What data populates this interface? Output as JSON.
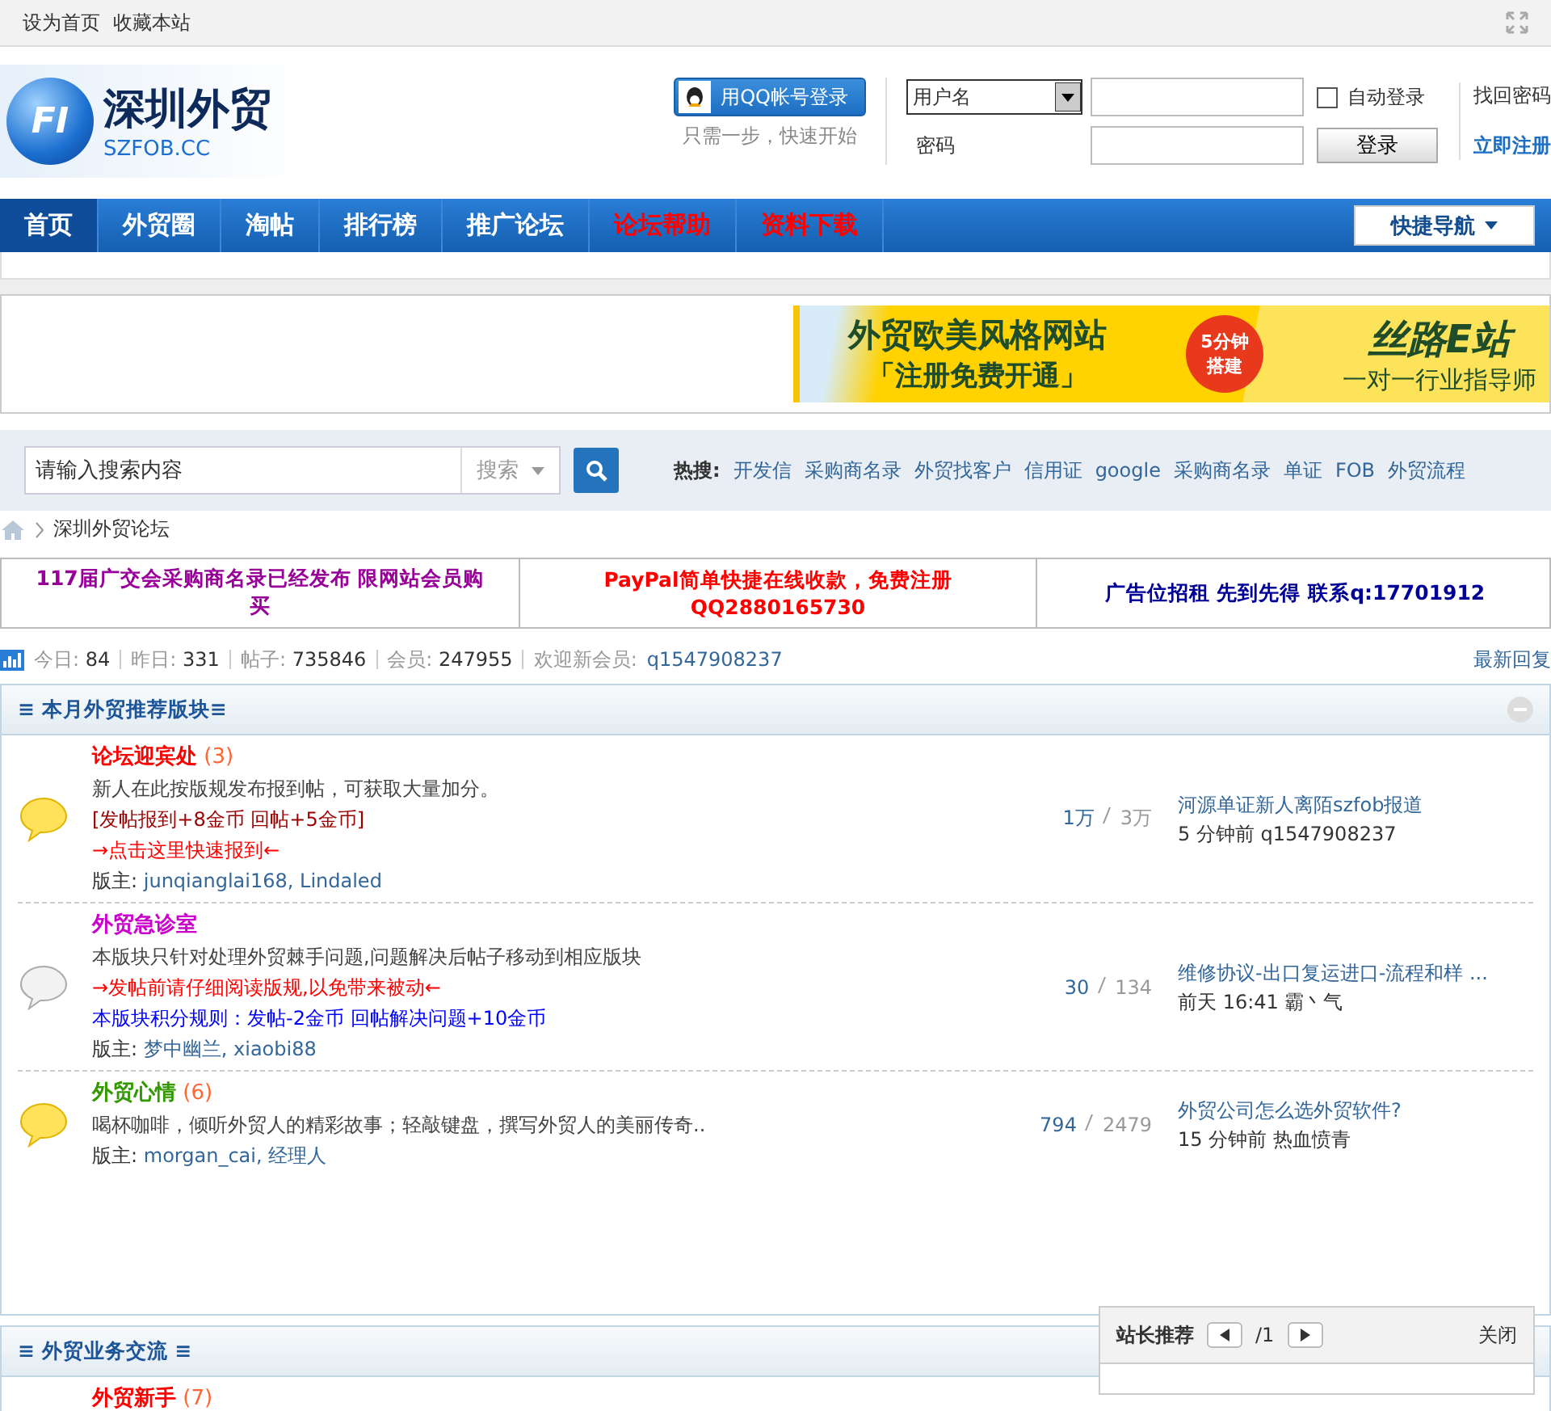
{
  "topbar": {
    "links": [
      "设为首页",
      "收藏本站"
    ]
  },
  "header": {
    "logo": {
      "mark": "FI",
      "name": "深圳外贸",
      "domain": "SZFOB.CC"
    },
    "qq_login": {
      "label": "用QQ帐号登录",
      "hint": "只需一步，快速开始"
    },
    "login": {
      "account_type": "用户名",
      "password_label": "密码",
      "auto_login": {
        "label": "自动登录",
        "checked": false
      },
      "submit": "登录",
      "links": [
        "找回密码",
        "立即注册"
      ]
    }
  },
  "nav": {
    "items": [
      {
        "label": "首页",
        "selected": true,
        "highlight": false
      },
      {
        "label": "外贸圈",
        "selected": false,
        "highlight": false
      },
      {
        "label": "淘帖",
        "selected": false,
        "highlight": false
      },
      {
        "label": "排行榜",
        "selected": false,
        "highlight": false
      },
      {
        "label": "推广论坛",
        "selected": false,
        "highlight": false
      },
      {
        "label": "论坛帮助",
        "selected": false,
        "highlight": true
      },
      {
        "label": "资料下载",
        "selected": false,
        "highlight": true
      }
    ],
    "quick_nav": "快捷导航"
  },
  "banner": {
    "headline": "外贸欧美风格网站",
    "subline": "「注册免费开通」",
    "badge": [
      "5分钟",
      "搭建"
    ],
    "brand": "丝路E站",
    "slogan": "一对一行业指导师"
  },
  "search": {
    "placeholder": "请输入搜索内容",
    "scope": "搜索",
    "hot_label": "热搜:",
    "hot": [
      "开发信",
      "采购商名录",
      "外贸找客户",
      "信用证",
      "google",
      "采购商名录",
      "单证",
      "FOB",
      "外贸流程"
    ]
  },
  "breadcrumb": [
    "深圳外贸论坛"
  ],
  "ads": [
    {
      "text": "117届广交会采购商名录已经发布  限网站会员购买",
      "color": "#990099"
    },
    {
      "text": "PayPal简单快捷在线收款，免费注册 QQ2880165730",
      "color": "#ff0000"
    },
    {
      "text": "广告位招租  先到先得  联系q:17701912",
      "color": "#000099"
    }
  ],
  "stats": {
    "items": [
      {
        "label": "今日:",
        "value": "84"
      },
      {
        "label": "昨日:",
        "value": "331"
      },
      {
        "label": "帖子:",
        "value": "735846"
      },
      {
        "label": "会员:",
        "value": "247955"
      }
    ],
    "welcome": "欢迎新会员:",
    "new_member": "q1547908237",
    "latest": "最新回复"
  },
  "sections": [
    {
      "title": "≡ 本月外贸推荐版块≡",
      "forums": [
        {
          "name": "论坛迎宾处",
          "color": "#ff0000",
          "count": "(3)",
          "new": true,
          "lines": [
            {
              "text": "新人在此按版规发布报到帖，可获取大量加分。",
              "color": "#444444"
            },
            {
              "text": "[发帖报到+8金币  回帖+5金币]",
              "color": "#990000"
            },
            {
              "text": "→点击这里快速报到←",
              "color": "#ff0000"
            }
          ],
          "moderators_label": "版主:",
          "moderators": "junqianglai168, Lindaled",
          "threads": "1万",
          "posts": "3万",
          "last_title": "河源单证新人离陌szfob报道",
          "last_meta": "5 分钟前  q1547908237"
        },
        {
          "name": "外贸急诊室",
          "color": "#cc00cc",
          "new": false,
          "lines": [
            {
              "text": "本版块只针对处理外贸棘手问题,问题解决后帖子移动到相应版块",
              "color": "#444444"
            },
            {
              "text": "→发帖前请仔细阅读版规,以免带来被动←",
              "color": "#ff0000"
            },
            {
              "text": "本版块积分规则：发帖-2金币  回帖解决问题+10金币",
              "color": "#0000ff"
            }
          ],
          "moderators_label": "版主:",
          "moderators": "梦中幽兰, xiaobi88",
          "threads": "30",
          "posts": "134",
          "last_title": "维修协议-出口复运进口-流程和样 ...",
          "last_meta": "前天 16:41  霸丶气"
        },
        {
          "name": "外贸心情",
          "color": "#339900",
          "count": "(6)",
          "new": true,
          "lines": [
            {
              "text": "喝杯咖啡，倾听外贸人的精彩故事；轻敲键盘，撰写外贸人的美丽传奇..",
              "color": "#444444"
            }
          ],
          "moderators_label": "版主:",
          "moderators": "morgan_cai, 经理人",
          "threads": "794",
          "posts": "2479",
          "last_title": "外贸公司怎么选外贸软件?",
          "last_meta": "15 分钟前  热血愤青"
        }
      ]
    },
    {
      "title": "≡ 外贸业务交流 ≡",
      "forums": [
        {
          "name": "外贸新手",
          "color": "#ff0000",
          "count": "(7)"
        }
      ]
    }
  ],
  "popup": {
    "title": "站长推荐",
    "page": "/1",
    "close": "关闭"
  }
}
